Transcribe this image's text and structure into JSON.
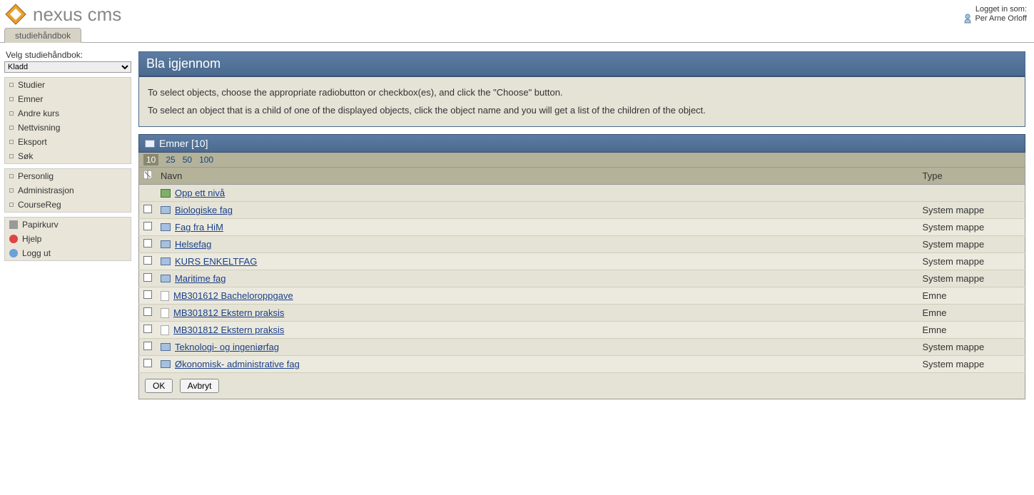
{
  "header": {
    "brand": "nexus cms",
    "logged_in_label": "Logget in som:",
    "user_name": "Per Arne Orloff"
  },
  "tab": {
    "label": "studiehåndbok"
  },
  "sidebar": {
    "select_label": "Velg studiehåndbok:",
    "select_value": "Kladd",
    "nav1": [
      "Studier",
      "Emner",
      "Andre kurs",
      "Nettvisning",
      "Eksport",
      "Søk"
    ],
    "nav2": [
      "Personlig",
      "Administrasjon",
      "CourseReg"
    ],
    "nav3": [
      {
        "icon": "trash",
        "label": "Papirkurv"
      },
      {
        "icon": "help",
        "label": "Hjelp"
      },
      {
        "icon": "logout",
        "label": "Logg ut"
      }
    ]
  },
  "panel": {
    "title": "Bla igjennom",
    "help_line1": "To select objects, choose the appropriate radiobutton or checkbox(es), and click the \"Choose\" button.",
    "help_line2": "To select an object that is a child of one of the displayed objects, click the object name and you will get a list of the children of the object."
  },
  "section": {
    "title": "Emner [10]"
  },
  "pager": {
    "options": [
      "10",
      "25",
      "50",
      "100"
    ],
    "active": "10"
  },
  "columns": {
    "name": "Navn",
    "type": "Type"
  },
  "up_row": {
    "label": "Opp ett nivå"
  },
  "rows": [
    {
      "icon": "folder",
      "name": "Biologiske fag",
      "type": "System mappe"
    },
    {
      "icon": "folder",
      "name": "Fag fra HiM",
      "type": "System mappe"
    },
    {
      "icon": "folder",
      "name": "Helsefag",
      "type": "System mappe"
    },
    {
      "icon": "folder",
      "name": "KURS ENKELTFAG",
      "type": "System mappe"
    },
    {
      "icon": "folder",
      "name": "Maritime fag",
      "type": "System mappe"
    },
    {
      "icon": "doc",
      "name": "MB301612 Bacheloroppgave",
      "type": "Emne"
    },
    {
      "icon": "doc",
      "name": "MB301812 Ekstern praksis",
      "type": "Emne"
    },
    {
      "icon": "doc",
      "name": "MB301812 Ekstern praksis",
      "type": "Emne"
    },
    {
      "icon": "folder",
      "name": "Teknologi- og ingeniørfag",
      "type": "System mappe"
    },
    {
      "icon": "folder",
      "name": "Økonomisk- administrative fag",
      "type": "System mappe"
    }
  ],
  "buttons": {
    "ok": "OK",
    "cancel": "Avbryt"
  }
}
